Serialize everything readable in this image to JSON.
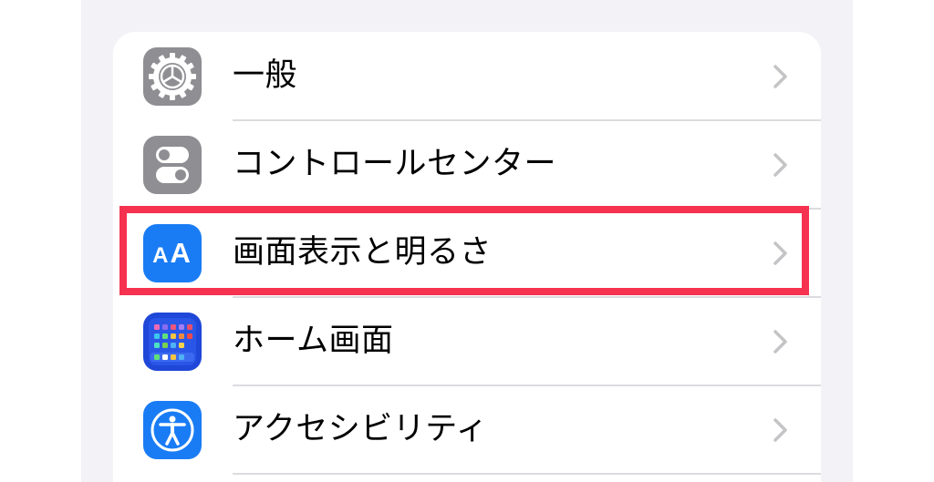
{
  "settings": {
    "items": [
      {
        "label": "一般",
        "icon": "gear-icon",
        "icon_bg": "#8e8e93"
      },
      {
        "label": "コントロールセンター",
        "icon": "toggles-icon",
        "icon_bg": "#8e8e93"
      },
      {
        "label": "画面表示と明るさ",
        "icon": "aa-text-size-icon",
        "icon_bg": "#1a7cf5",
        "icon_text_small": "A",
        "icon_text_big": "A",
        "highlighted": true
      },
      {
        "label": "ホーム画面",
        "icon": "home-screen-grid-icon",
        "icon_bg": "#1f47d8"
      },
      {
        "label": "アクセシビリティ",
        "icon": "accessibility-icon",
        "icon_bg": "#1a7cf5"
      }
    ]
  },
  "highlight_color": "#f5324f"
}
